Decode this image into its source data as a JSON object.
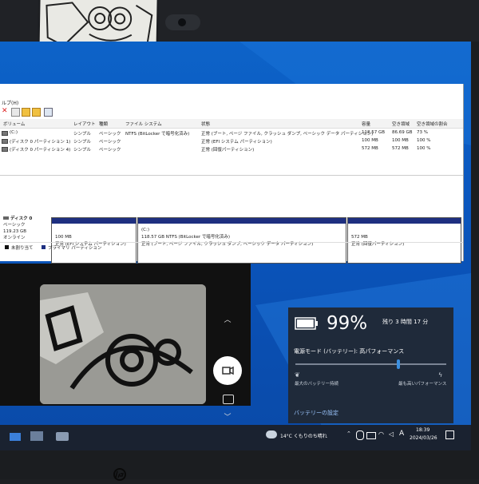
{
  "window": {
    "menu_help": "ルプ(H)",
    "columns": [
      "ボリューム",
      "レイアウト",
      "種類",
      "ファイル システム",
      "状態",
      "容量",
      "空き領域",
      "空き領域の割合"
    ],
    "rows": [
      [
        "(C:)",
        "シンプル",
        "ベーシック",
        "NTFS (BitLocker で暗号化済み)",
        "正常 (ブート, ページ ファイル, クラッシュ ダンプ, ベーシック データ パーティション)",
        "118.57 GB",
        "86.69 GB",
        "73 %"
      ],
      [
        "(ディスク 0 パーティション 1)",
        "シンプル",
        "ベーシック",
        "",
        "正常 (EFI システム パーティション)",
        "100 MB",
        "100 MB",
        "100 %"
      ],
      [
        "(ディスク 0 パーティション 4)",
        "シンプル",
        "ベーシック",
        "",
        "正常 (回復パーティション)",
        "572 MB",
        "572 MB",
        "100 %"
      ]
    ],
    "disk": {
      "name": "ディスク 0",
      "type": "ベーシック",
      "size": "119.23 GB",
      "status": "オンライン"
    },
    "partitions": [
      {
        "title": "",
        "size": "100 MB",
        "status": "正常 (EFI システム パーティション)"
      },
      {
        "title": "(C:)",
        "size": "118.57 GB NTFS (BitLocker で暗号化済み)",
        "status": "正常 (ブート, ページ ファイル, クラッシュ ダンプ, ベーシック データ パーティション)"
      },
      {
        "title": "",
        "size": "572 MB",
        "status": "正常 (回復パーティション)"
      }
    ],
    "legend": {
      "unallocated": "未割り当て",
      "primary": "プライマリ パーティション"
    }
  },
  "battery": {
    "percent": "99%",
    "remaining": "残り 3 時間 17 分",
    "mode": "電源モード (バッテリー): 高パフォーマンス",
    "left_label": "最大のバッテリー持続",
    "right_label": "最も高いパフォーマンス",
    "settings_link": "バッテリーの設定",
    "level": 0.99,
    "slider_position": 0.68
  },
  "taskbar": {
    "weather": "14°C くもりのち晴れ",
    "ime": "A",
    "time": "18:39",
    "date": "2024/03/26"
  },
  "colors": {
    "partition_bar": "#1e2f80",
    "unallocated": "#111111",
    "accent": "#3b8fe0"
  }
}
